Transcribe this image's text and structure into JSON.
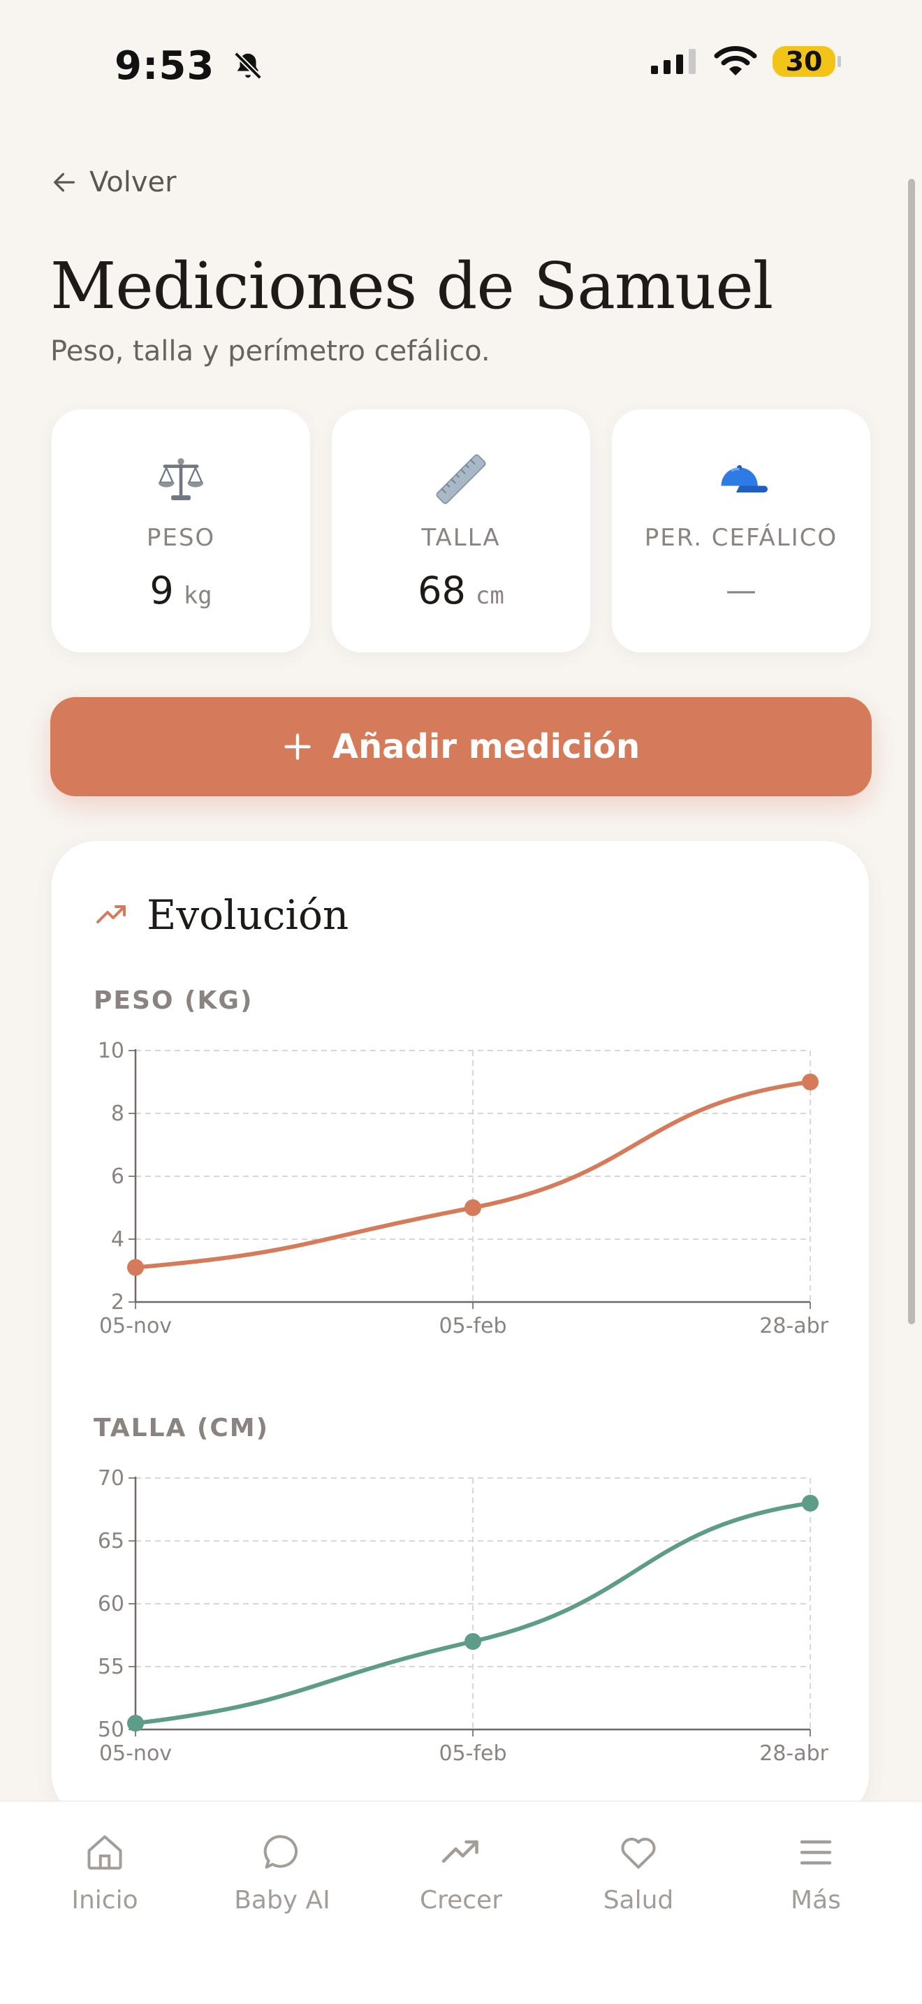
{
  "status": {
    "time": "9:53",
    "battery": "30"
  },
  "header": {
    "back_label": "Volver",
    "title": "Mediciones de Samuel",
    "subtitle": "Peso, talla y perímetro cefálico."
  },
  "cards": [
    {
      "label": "PESO",
      "value": "9",
      "unit": "kg",
      "icon": "scale-icon"
    },
    {
      "label": "TALLA",
      "value": "68",
      "unit": "cm",
      "icon": "ruler-icon"
    },
    {
      "label": "PER. CEFÁLICO",
      "value": "—",
      "unit": "",
      "icon": "cap-icon"
    }
  ],
  "add_button": {
    "label": "Añadir medición",
    "icon": "plus-icon"
  },
  "evolution": {
    "title": "Evolución",
    "icon": "trend-up-icon"
  },
  "colors": {
    "accent": "#d57b59",
    "weight_series": "#d57b59",
    "height_series": "#5c9c88"
  },
  "chart_data": [
    {
      "type": "line",
      "title": "PESO (KG)",
      "x": [
        "05-nov",
        "05-feb",
        "28-abr"
      ],
      "series": [
        {
          "values": [
            3.1,
            5.0,
            9.0
          ]
        }
      ],
      "yticks": [
        2,
        4,
        6,
        8,
        10
      ],
      "ylim": [
        2,
        10
      ],
      "grid": true
    },
    {
      "type": "line",
      "title": "TALLA (CM)",
      "x": [
        "05-nov",
        "05-feb",
        "28-abr"
      ],
      "series": [
        {
          "values": [
            50.5,
            57,
            68
          ]
        }
      ],
      "yticks": [
        50,
        55,
        60,
        65,
        70
      ],
      "ylim": [
        50,
        70
      ],
      "grid": true
    }
  ],
  "tabs": [
    {
      "label": "Inicio",
      "icon": "home-icon"
    },
    {
      "label": "Baby AI",
      "icon": "chat-bubble-icon"
    },
    {
      "label": "Crecer",
      "icon": "trend-up-icon"
    },
    {
      "label": "Salud",
      "icon": "heart-icon"
    },
    {
      "label": "Más",
      "icon": "menu-icon"
    }
  ]
}
